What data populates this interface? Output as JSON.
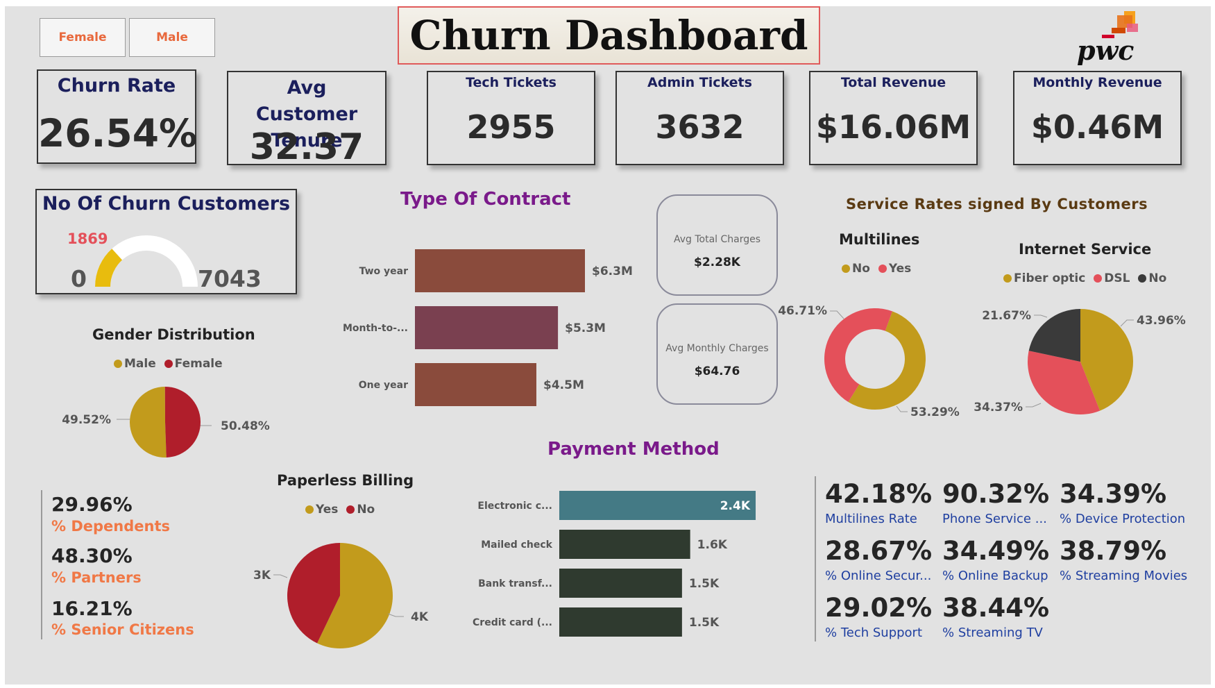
{
  "title": "Churn Dashboard",
  "slicers": [
    "Female",
    "Male"
  ],
  "logo": {
    "text": "pwc"
  },
  "cards": [
    {
      "title": "Churn Rate",
      "value": "26.54%"
    },
    {
      "title": "Avg Customer Tenure",
      "value": "32.37"
    },
    {
      "title": "Tech Tickets",
      "value": "2955"
    },
    {
      "title": "Admin Tickets",
      "value": "3632"
    },
    {
      "title": "Total Revenue",
      "value": "$16.06M"
    },
    {
      "title": "Monthly Revenue",
      "value": "$0.46M"
    }
  ],
  "gauge": {
    "title": "No Of Churn Customers",
    "value": 1869,
    "value_label": "1869",
    "min_label": "0",
    "max_label": "7043",
    "max": 7043
  },
  "charges": [
    {
      "title": "Avg Total Charges",
      "value": "$2.28K"
    },
    {
      "title": "Avg Monthly Charges",
      "value": "$64.76"
    }
  ],
  "overview": [
    {
      "value": "29.96%",
      "label": "% Dependents"
    },
    {
      "value": "48.30%",
      "label": "% Partners"
    },
    {
      "value": "16.21%",
      "label": "% Senior Citizens"
    }
  ],
  "service_title": "Service Rates signed By Customers",
  "service_kpis": [
    {
      "value": "42.18%",
      "label": "Multilines Rate"
    },
    {
      "value": "90.32%",
      "label": "Phone Service ..."
    },
    {
      "value": "34.39%",
      "label": "% Device Protection"
    },
    {
      "value": "28.67%",
      "label": "% Online Secur..."
    },
    {
      "value": "34.49%",
      "label": "% Online Backup"
    },
    {
      "value": "38.79%",
      "label": "% Streaming Movies"
    },
    {
      "value": "29.02%",
      "label": "% Tech Support"
    },
    {
      "value": "38.44%",
      "label": "% Streaming TV"
    }
  ],
  "colors": {
    "gold": "#c29b1c",
    "red": "#b01e2b",
    "coral": "#e4505a",
    "dark": "#3a3a3a",
    "brown": "#8a4b3c",
    "plum": "#7a4050",
    "teal": "#447a85",
    "darkgreen": "#2f3a2f"
  },
  "chart_data": [
    {
      "id": "contract",
      "type": "bar",
      "orientation": "horizontal",
      "title": "Type Of Contract",
      "categories": [
        "Two year",
        "Month-to-...",
        "One year"
      ],
      "values": [
        6.3,
        5.3,
        4.5
      ],
      "data_labels": [
        "$6.3M",
        "$5.3M",
        "$4.5M"
      ],
      "colors": [
        "#8a4b3c",
        "#7a4050",
        "#8a4b3c"
      ],
      "xlim": [
        0,
        6.3
      ]
    },
    {
      "id": "payment",
      "type": "bar",
      "orientation": "horizontal",
      "title": "Payment Method",
      "categories": [
        "Electronic c...",
        "Mailed check",
        "Bank transf...",
        "Credit card (..."
      ],
      "values": [
        2.4,
        1.6,
        1.5,
        1.5
      ],
      "data_labels": [
        "2.4K",
        "1.6K",
        "1.5K",
        "1.5K"
      ],
      "colors": [
        "#447a85",
        "#2f3a2f",
        "#2f3a2f",
        "#2f3a2f"
      ],
      "xlim": [
        0,
        2.4
      ]
    },
    {
      "id": "gender",
      "type": "pie",
      "title": "Gender Distribution",
      "legend": [
        {
          "name": "Male",
          "color": "#c29b1c"
        },
        {
          "name": "Female",
          "color": "#b01e2b"
        }
      ],
      "slices": [
        {
          "name": "Male",
          "value": 50.48,
          "label": "50.48%"
        },
        {
          "name": "Female",
          "value": 49.52,
          "label": "49.52%"
        }
      ]
    },
    {
      "id": "paperless",
      "type": "pie",
      "title": "Paperless Billing",
      "legend": [
        {
          "name": "Yes",
          "color": "#c29b1c"
        },
        {
          "name": "No",
          "color": "#b01e2b"
        }
      ],
      "slices": [
        {
          "name": "Yes",
          "value": 4,
          "label": "4K"
        },
        {
          "name": "No",
          "value": 3,
          "label": "3K"
        }
      ]
    },
    {
      "id": "multilines",
      "type": "pie",
      "subtype": "donut",
      "title": "Multilines",
      "legend": [
        {
          "name": "No",
          "color": "#c29b1c"
        },
        {
          "name": "Yes",
          "color": "#e4505a"
        }
      ],
      "slices": [
        {
          "name": "No",
          "value": 53.29,
          "label": "53.29%"
        },
        {
          "name": "Yes",
          "value": 46.71,
          "label": "46.71%"
        }
      ]
    },
    {
      "id": "internet",
      "type": "pie",
      "title": "Internet Service",
      "legend": [
        {
          "name": "Fiber optic",
          "color": "#c29b1c"
        },
        {
          "name": "DSL",
          "color": "#e4505a"
        },
        {
          "name": "No",
          "color": "#3a3a3a"
        }
      ],
      "slices": [
        {
          "name": "Fiber optic",
          "value": 43.96,
          "label": "43.96%"
        },
        {
          "name": "DSL",
          "value": 34.37,
          "label": "34.37%"
        },
        {
          "name": "No",
          "value": 21.67,
          "label": "21.67%"
        }
      ]
    }
  ]
}
